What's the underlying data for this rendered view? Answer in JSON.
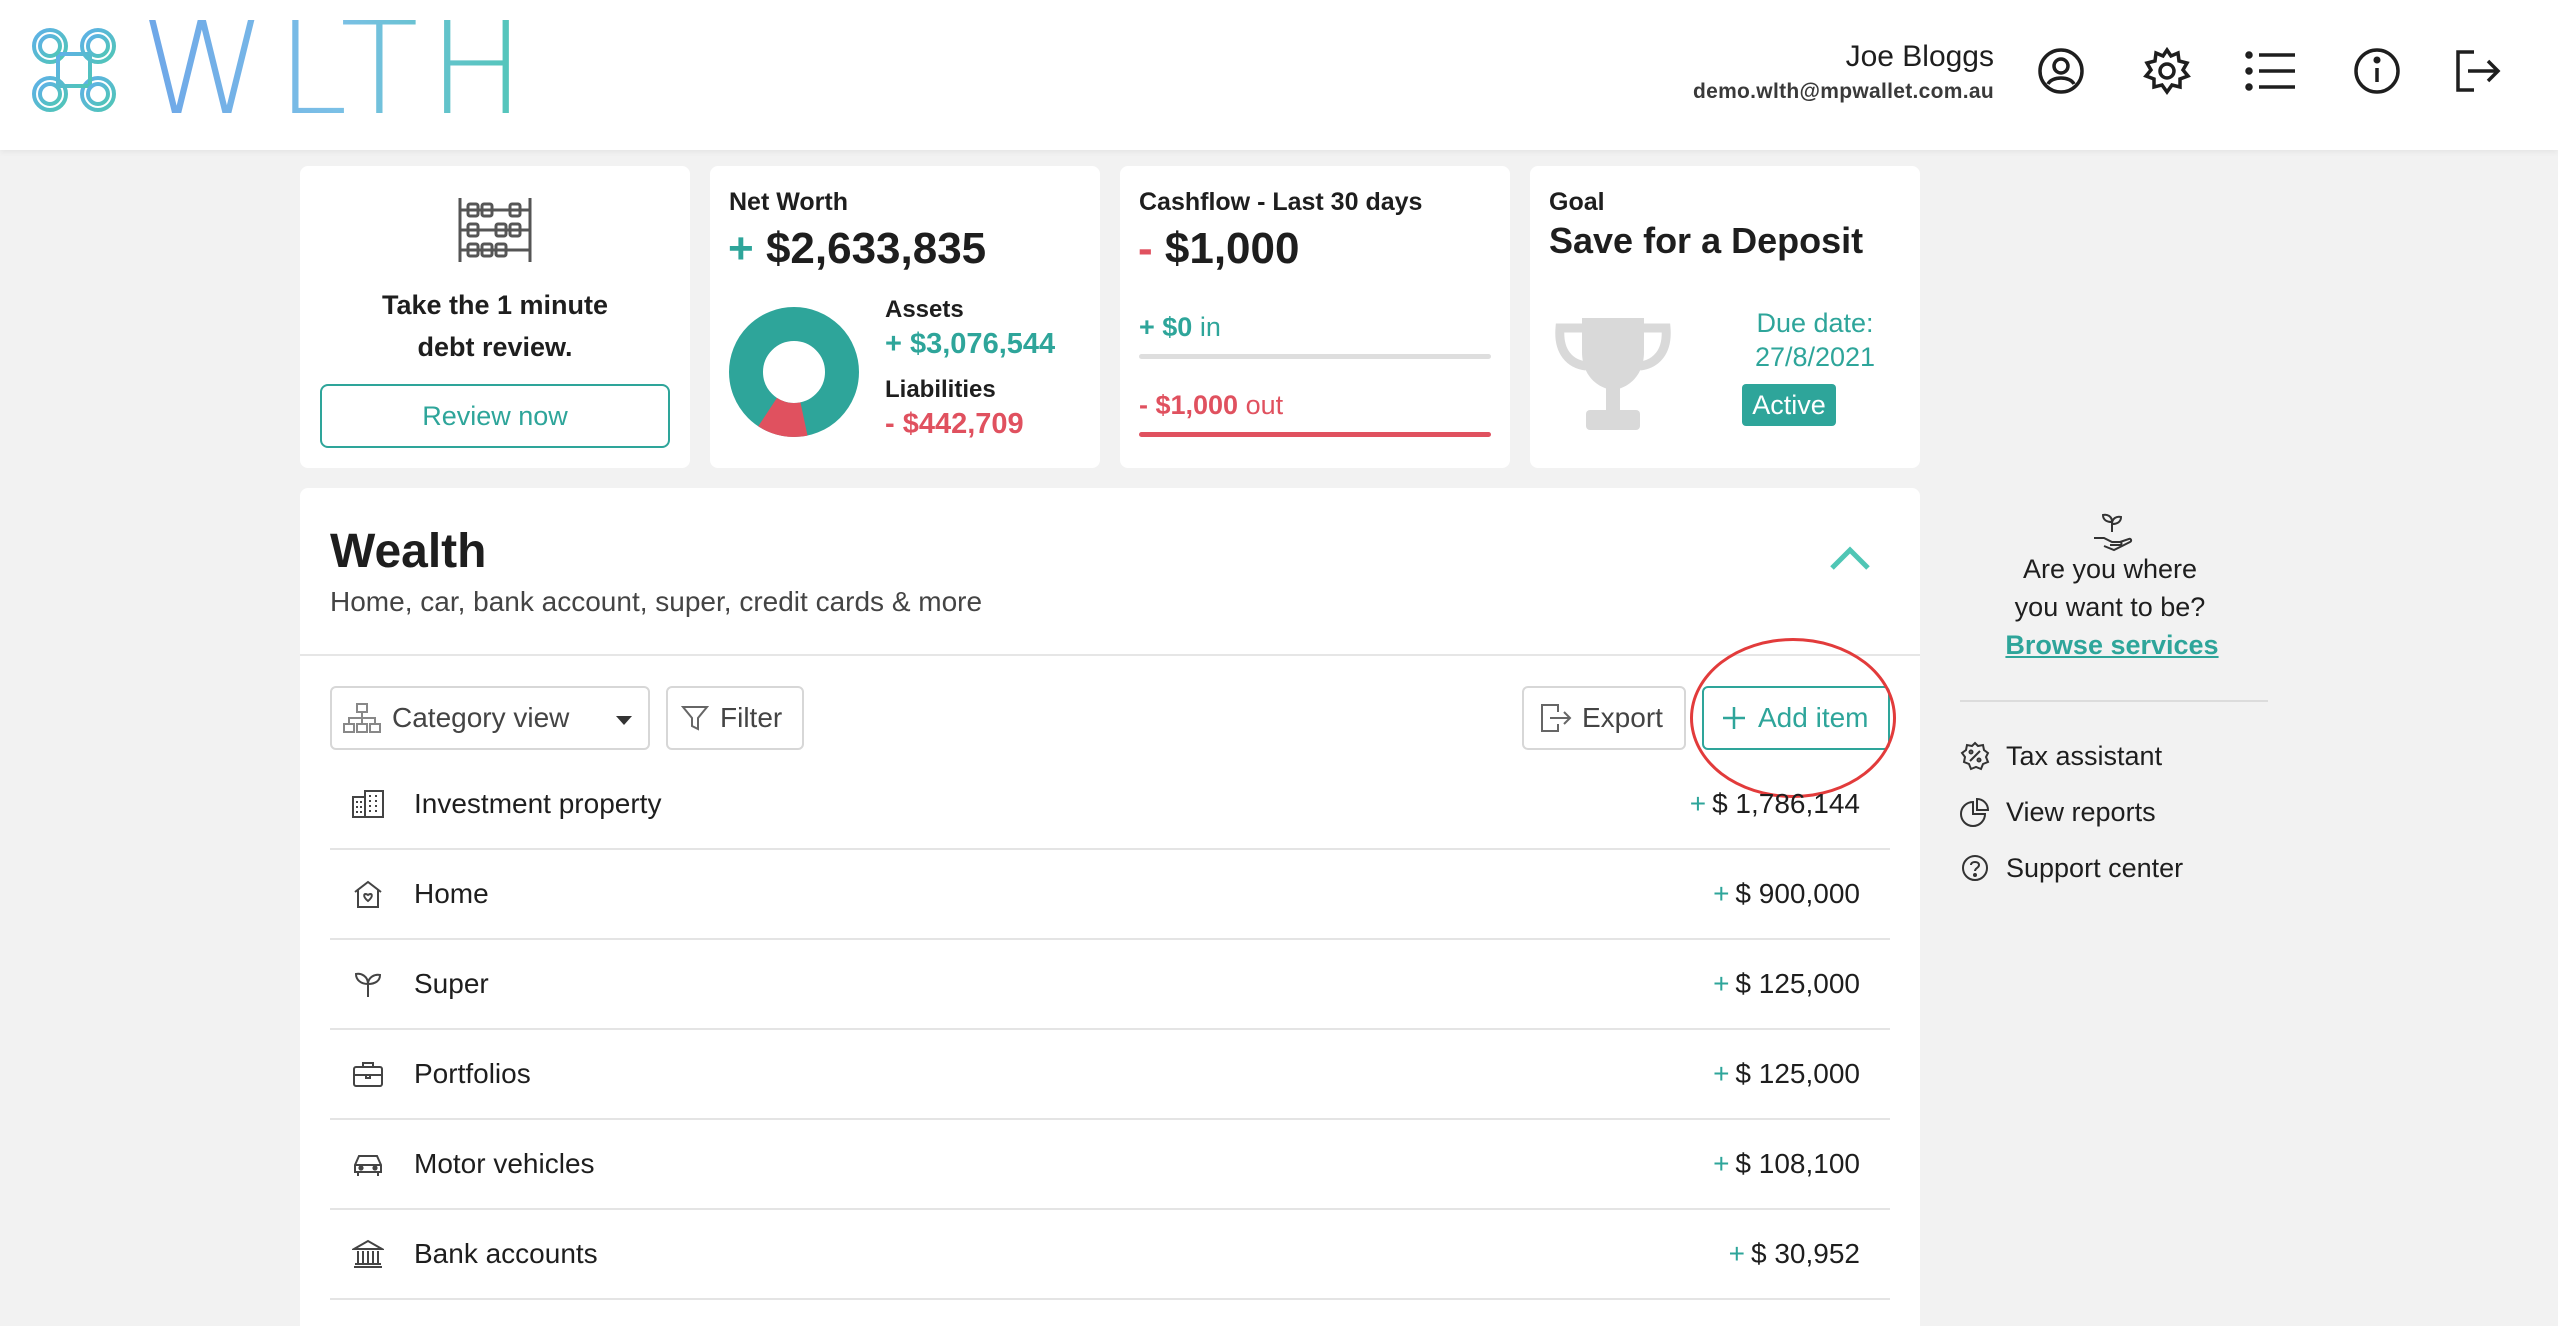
{
  "brand": {
    "logo_text": "WLTH"
  },
  "user": {
    "name": "Joe Bloggs",
    "email": "demo.wlth@mpwallet.com.au"
  },
  "header_icons": [
    "account-icon",
    "settings-icon",
    "list-icon",
    "info-icon",
    "logout-icon"
  ],
  "debt_review": {
    "line1": "Take the 1 minute",
    "line2": "debt review.",
    "button": "Review now"
  },
  "net_worth": {
    "title": "Net Worth",
    "sign": "+",
    "value": "$2,633,835",
    "assets_label": "Assets",
    "assets_value": "+ $3,076,544",
    "liabilities_label": "Liabilities",
    "liabilities_value": "- $442,709",
    "assets_fraction": 0.874
  },
  "cashflow": {
    "title": "Cashflow - Last 30 days",
    "sign": "-",
    "value": "$1,000",
    "in_amount": "+ $0",
    "in_label": "in",
    "out_amount": "- $1,000",
    "out_label": "out"
  },
  "goal": {
    "title": "Goal",
    "name": "Save for a Deposit",
    "due_label": "Due date:",
    "due_date": "27/8/2021",
    "status": "Active"
  },
  "wealth": {
    "title": "Wealth",
    "subtitle": "Home, car, bank account, super, credit cards & more",
    "toolbar": {
      "category_view": "Category view",
      "filter": "Filter",
      "export": "Export",
      "add_item": "Add item"
    },
    "items": [
      {
        "label": "Investment property",
        "sign": "+",
        "value": "$ 1,786,144",
        "icon": "building-icon"
      },
      {
        "label": "Home",
        "sign": "+",
        "value": "$ 900,000",
        "icon": "home-icon"
      },
      {
        "label": "Super",
        "sign": "+",
        "value": "$ 125,000",
        "icon": "sprout-icon"
      },
      {
        "label": "Portfolios",
        "sign": "+",
        "value": "$ 125,000",
        "icon": "briefcase-icon"
      },
      {
        "label": "Motor vehicles",
        "sign": "+",
        "value": "$ 108,100",
        "icon": "car-icon"
      },
      {
        "label": "Bank accounts",
        "sign": "+",
        "value": "$ 30,952",
        "icon": "bank-icon"
      }
    ]
  },
  "sidebar": {
    "question_line1": "Are you where",
    "question_line2": "you want to be?",
    "link": "Browse services",
    "items": [
      {
        "label": "Tax assistant",
        "icon": "percent-badge-icon"
      },
      {
        "label": "View reports",
        "icon": "pie-chart-icon"
      },
      {
        "label": "Support center",
        "icon": "help-icon"
      }
    ]
  },
  "colors": {
    "teal": "#2ea59a",
    "red": "#e0515f",
    "background": "#f2f2f2",
    "highlight_ring": "#e23b3b"
  }
}
